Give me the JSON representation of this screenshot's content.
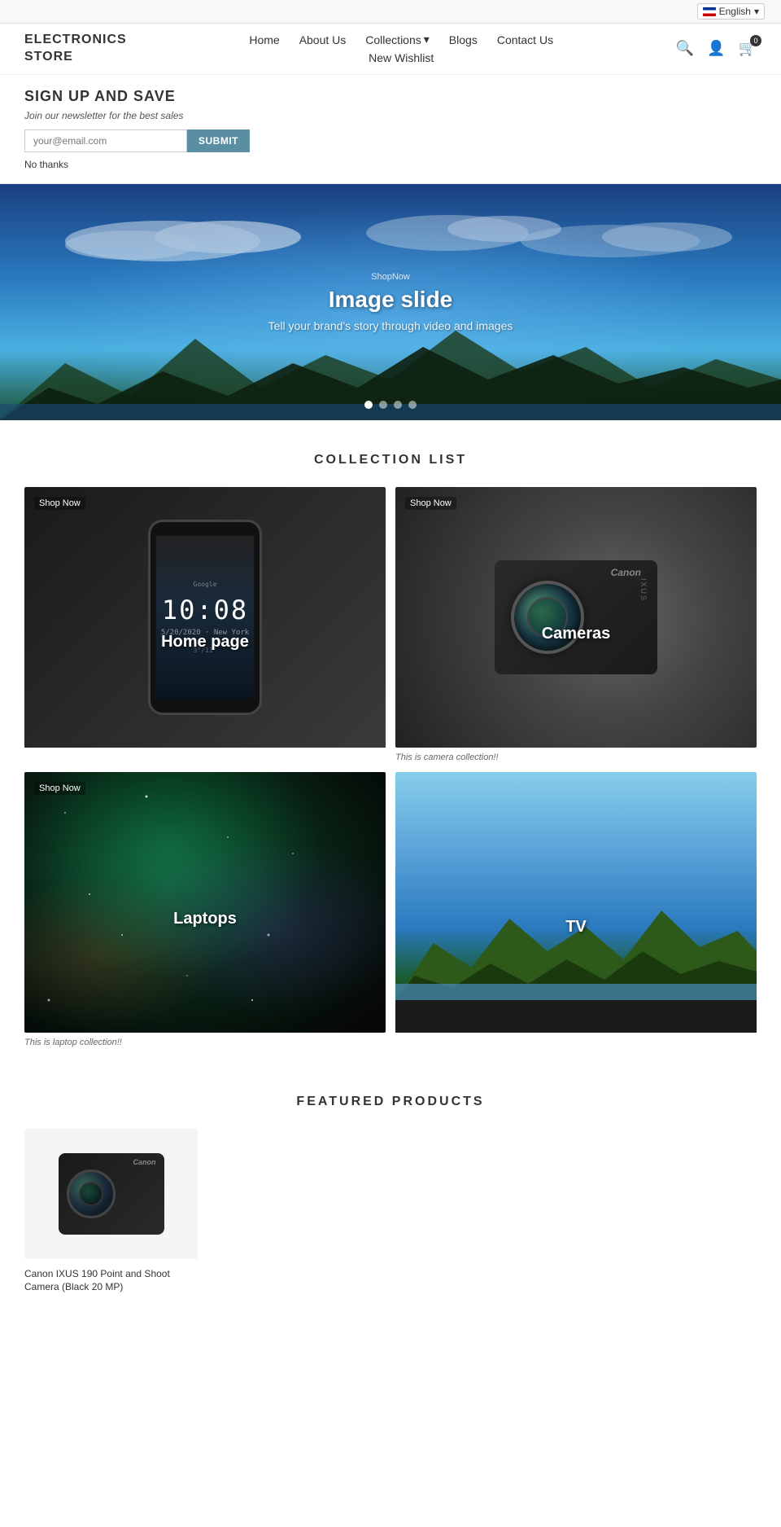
{
  "topbar": {
    "language": "English",
    "flag": "en"
  },
  "header": {
    "logo_line1": "ELECTRONICS",
    "logo_line2": "STORE",
    "nav": {
      "home": "Home",
      "about": "About Us",
      "collections": "Collections",
      "blogs": "Blogs",
      "contact": "Contact Us",
      "wishlist": "New Wishlist"
    }
  },
  "newsletter": {
    "heading": "SIGN UP AND SAVE",
    "subtext": "Join our newsletter for the best sales",
    "input_placeholder": "your@email.com",
    "button_label": "SUBMIT",
    "no_thanks": "No thanks"
  },
  "hero": {
    "shop_now": "ShopNow",
    "title": "Image slide",
    "subtitle": "Tell your brand's story through video and images",
    "dots": [
      true,
      false,
      false,
      false
    ]
  },
  "collection_list": {
    "section_title": "COLLECTION LIST",
    "items": [
      {
        "id": "home-page",
        "label": "Home page",
        "shop_now": "Shop Now",
        "desc": ""
      },
      {
        "id": "cameras",
        "label": "Cameras",
        "shop_now": "Shop Now",
        "desc": "This is camera collection!!"
      },
      {
        "id": "laptops",
        "label": "Laptops",
        "shop_now": "Shop Now",
        "desc": "This is laptop collection!!"
      },
      {
        "id": "tv",
        "label": "TV",
        "shop_now": "",
        "desc": ""
      }
    ]
  },
  "featured_products": {
    "section_title": "FEATURED PRODUCTS",
    "items": [
      {
        "id": "canon-ixus-190",
        "name": "Canon IXUS 190 Point and Shoot Camera (Black 20 MP)"
      }
    ]
  }
}
